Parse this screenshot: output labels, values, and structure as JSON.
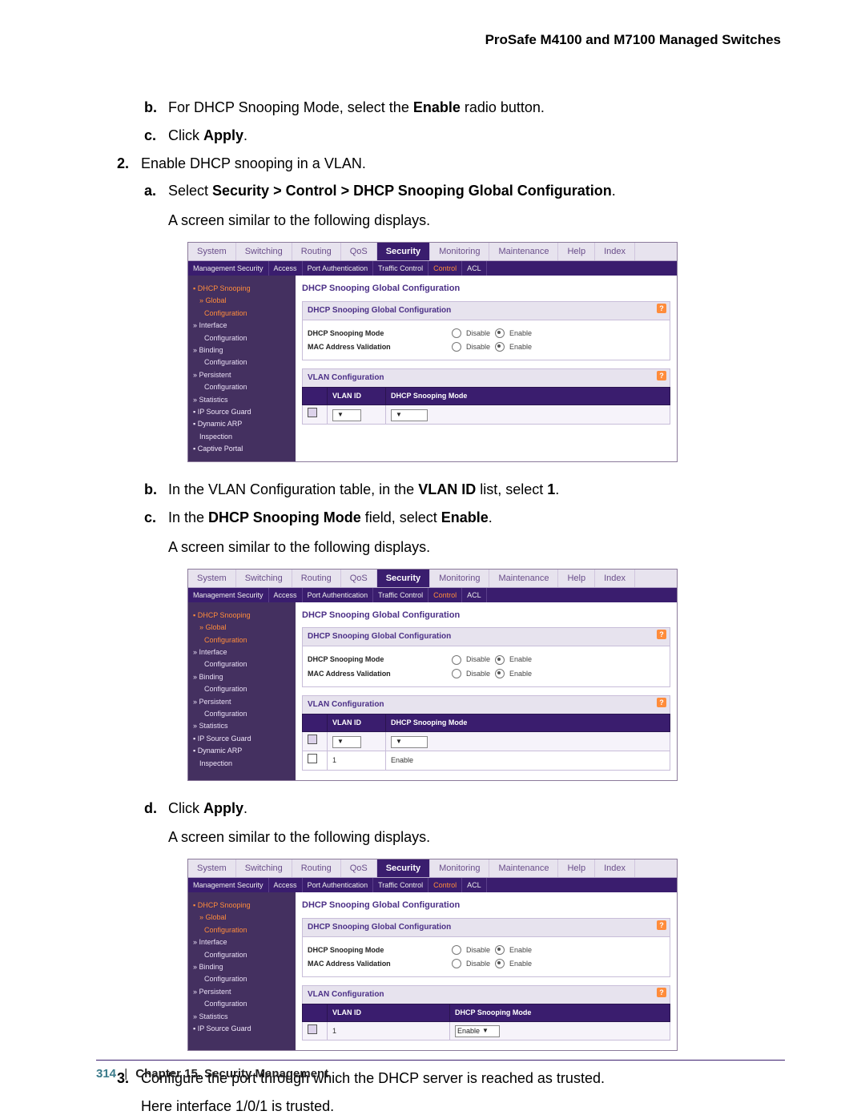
{
  "header": {
    "title": "ProSafe M4100 and M7100 Managed Switches"
  },
  "body": {
    "s1b_prefix": "For DHCP Snooping Mode, select the ",
    "s1b_bold": "Enable",
    "s1b_suffix": " radio button.",
    "s1c_prefix": "Click ",
    "s1c_bold": "Apply",
    "s1c_suffix": ".",
    "s2_text": "Enable DHCP snooping in a VLAN.",
    "s2a_prefix": "Select ",
    "s2a_bold": "Security > Control > DHCP Snooping Global Configuration",
    "s2a_suffix": ".",
    "similar": "A screen similar to the following displays.",
    "s2b_prefix": "In the VLAN Configuration table, in the ",
    "s2b_bold": "VLAN ID",
    "s2b_mid": " list, select ",
    "s2b_bold2": "1",
    "s2b_suffix": ".",
    "s2c_prefix": "In the ",
    "s2c_bold": "DHCP Snooping Mode",
    "s2c_mid": " field, select ",
    "s2c_bold2": "Enable",
    "s2c_suffix": ".",
    "s2d_prefix": "Click ",
    "s2d_bold": "Apply",
    "s2d_suffix": ".",
    "s3_text": "Configure the port through which the DHCP server is reached as trusted.",
    "s3_sub": "Here interface 1/0/1 is trusted.",
    "label_b": "b.",
    "label_c": "c.",
    "label_d": "d.",
    "label_a": "a.",
    "label_2": "2.",
    "label_3": "3."
  },
  "ui": {
    "tabs": [
      "System",
      "Switching",
      "Routing",
      "QoS",
      "Security",
      "Monitoring",
      "Maintenance",
      "Help",
      "Index"
    ],
    "subtabs": [
      "Management Security",
      "Access",
      "Port Authentication",
      "Traffic Control",
      "Control",
      "ACL"
    ],
    "sidebar": {
      "group1": "DHCP Snooping",
      "items1": [
        "Global",
        "Configuration",
        "Interface",
        "Configuration",
        "Binding",
        "Configuration",
        "Persistent",
        "Configuration",
        "Statistics"
      ],
      "link1": "IP Source Guard",
      "link2": "Dynamic ARP",
      "link2b": "Inspection",
      "link3": "Captive Portal"
    },
    "sect_title": "DHCP Snooping Global Configuration",
    "panel1_title": "DHCP Snooping Global Configuration",
    "row1_label": "DHCP Snooping Mode",
    "row2_label": "MAC Address Validation",
    "opt_disable": "Disable",
    "opt_enable": "Enable",
    "panel2_title": "VLAN Configuration",
    "col_vlan": "VLAN ID",
    "col_mode": "DHCP Snooping Mode",
    "val_1": "1",
    "val_enable": "Enable"
  },
  "footer": {
    "page": "314",
    "chapter": "Chapter 15.  Security Management"
  }
}
